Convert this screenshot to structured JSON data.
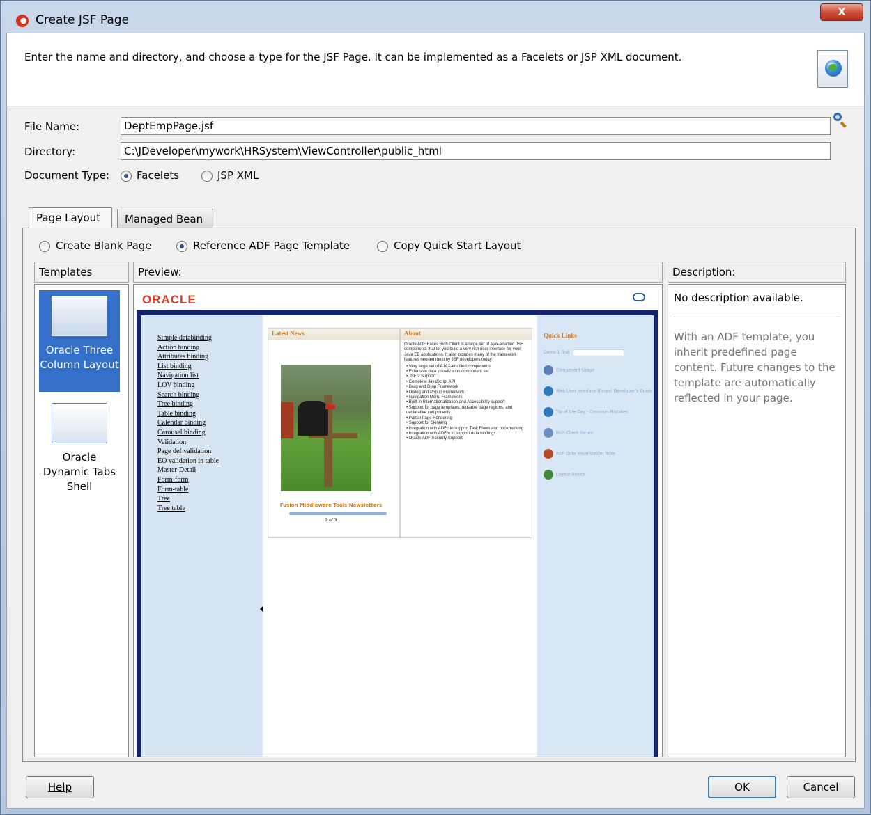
{
  "window": {
    "title": "Create JSF Page",
    "close_label": "X"
  },
  "header": {
    "instruction": "Enter the name and directory, and choose a type for the JSF Page. It can be implemented as a Facelets or JSP XML document."
  },
  "form": {
    "file_name_label": "File Name:",
    "file_name_value": "DeptEmpPage.jsf",
    "directory_label": "Directory:",
    "directory_value": "C:\\JDeveloper\\mywork\\HRSystem\\ViewController\\public_html",
    "document_type_label": "Document Type:",
    "doc_types": [
      {
        "label": "Facelets",
        "selected": true
      },
      {
        "label": "JSP XML",
        "selected": false
      }
    ]
  },
  "tabs": [
    {
      "label": "Page Layout",
      "active": true
    },
    {
      "label": "Managed Bean",
      "active": false
    }
  ],
  "layout_options": [
    {
      "label": "Create Blank Page",
      "selected": false
    },
    {
      "label": "Reference ADF Page Template",
      "selected": true
    },
    {
      "label": "Copy Quick Start Layout",
      "selected": false
    }
  ],
  "templates": {
    "heading": "Templates",
    "items": [
      {
        "label": "Oracle Three Column Layout",
        "selected": true
      },
      {
        "label": "Oracle Dynamic Tabs Shell",
        "selected": false
      }
    ]
  },
  "preview": {
    "heading": "Preview:",
    "brand": "ORACLE",
    "left_links": [
      "Simple databinding",
      "Action binding",
      "Attributes binding",
      "List binding",
      "Navigation list",
      "LOV binding",
      "Search binding",
      "Tree binding",
      "Table binding",
      "Calendar binding",
      "Carousel binding",
      "Validation",
      "Page def validation",
      "EO validation in table",
      "Master-Detail",
      "Form-form",
      "Form-table",
      "Tree",
      "Tree table"
    ],
    "latest_news_title": "Latest News",
    "carousel_caption": "Fusion Middleware Tools Newsletters",
    "carousel_count": "2 of 3",
    "about_title": "About",
    "about_text": "Oracle ADF Faces Rich Client is a large set of Ajax-enabled JSF components that let you build a very rich user interface for your Java EE applications. It also includes many of the framework features needed most by JSF developers today.",
    "about_bullets": [
      "Very large set of AJAX-enabled components",
      "Extensive data visualization component set",
      "JSF 2 Support",
      "Complete JavaScript API",
      "Drag and Drop Framework",
      "Dialog and Popup Framework",
      "Navigation Menu Framework",
      "Built-in Internationalization and Accessibility support",
      "Support for page templates, reusable page regions, and declarative components",
      "Partial Page Rendering",
      "Support for Skinning",
      "Integration with ADFc to support Task Flows and bookmarking",
      "Integration with ADFm to support data bindings.",
      "Oracle ADF Security Support"
    ],
    "quick_links_title": "Quick Links",
    "quick_links_search_label": "Demo 1 find",
    "quick_links": [
      "Component Usage",
      "Web User Interface (Faces) Developer's Guide",
      "Tip of the Day - Common Mistakes",
      "Rich Client Forum",
      "ADF Data Visualization Tools",
      "Layout Basics"
    ]
  },
  "description": {
    "heading": "Description:",
    "summary": "No description available.",
    "body": "With an ADF template, you inherit predefined page content. Future changes to the template are automatically reflected in your page."
  },
  "buttons": {
    "help": "Help",
    "ok": "OK",
    "cancel": "Cancel"
  },
  "colors": {
    "selection": "#3470c9",
    "oracle_red": "#e03a1e",
    "preview_frame": "#12246b"
  }
}
